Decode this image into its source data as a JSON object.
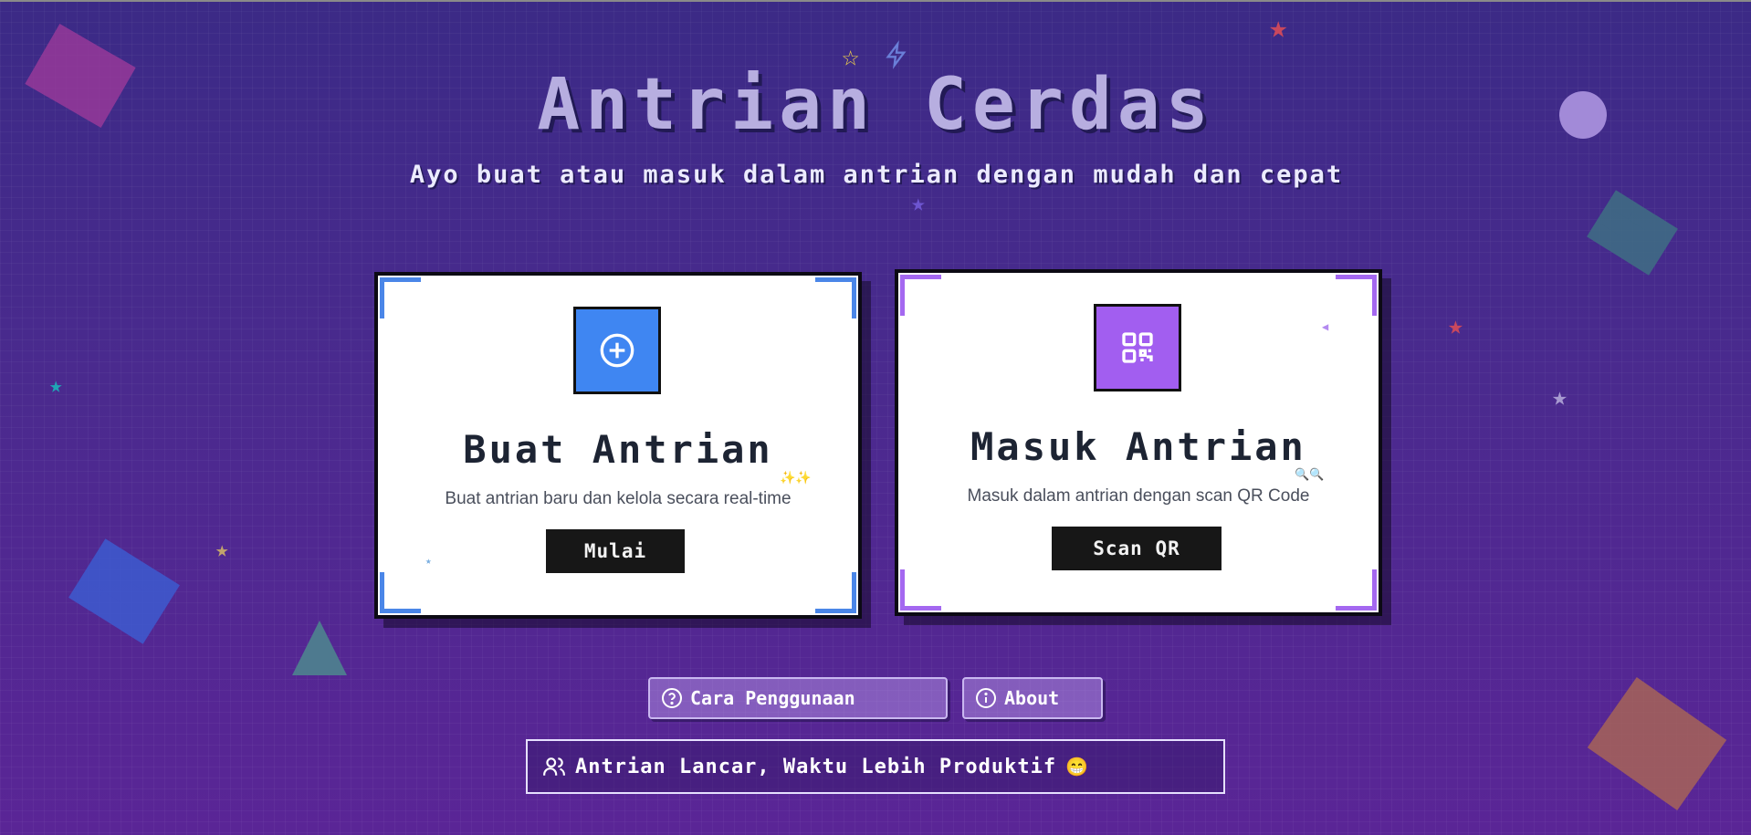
{
  "header": {
    "title": "Antrian Cerdas",
    "subtitle": "Ayo buat atau masuk dalam antrian dengan mudah dan cepat"
  },
  "cards": [
    {
      "title": "Buat Antrian",
      "description": "Buat antrian baru dan kelola secara real-time",
      "button_label": "Mulai",
      "icon": "plus-circle-icon",
      "accent": "#3f86f2",
      "sparkle": "✨✨"
    },
    {
      "title": "Masuk Antrian",
      "description": "Masuk dalam antrian dengan scan QR Code",
      "button_label": "Scan QR",
      "icon": "qr-code-icon",
      "accent": "#a25ef0",
      "sparkle": "🔍🔍"
    }
  ],
  "nav": {
    "help_label": "Cara Penggunaan",
    "about_label": "About"
  },
  "footer": {
    "banner_text": "Antrian Lancar, Waktu Lebih Produktif",
    "banner_emoji": "😁"
  },
  "colors": {
    "background": "#4a2a8e",
    "blue_accent": "#3f86f2",
    "purple_accent": "#a25ef0"
  }
}
